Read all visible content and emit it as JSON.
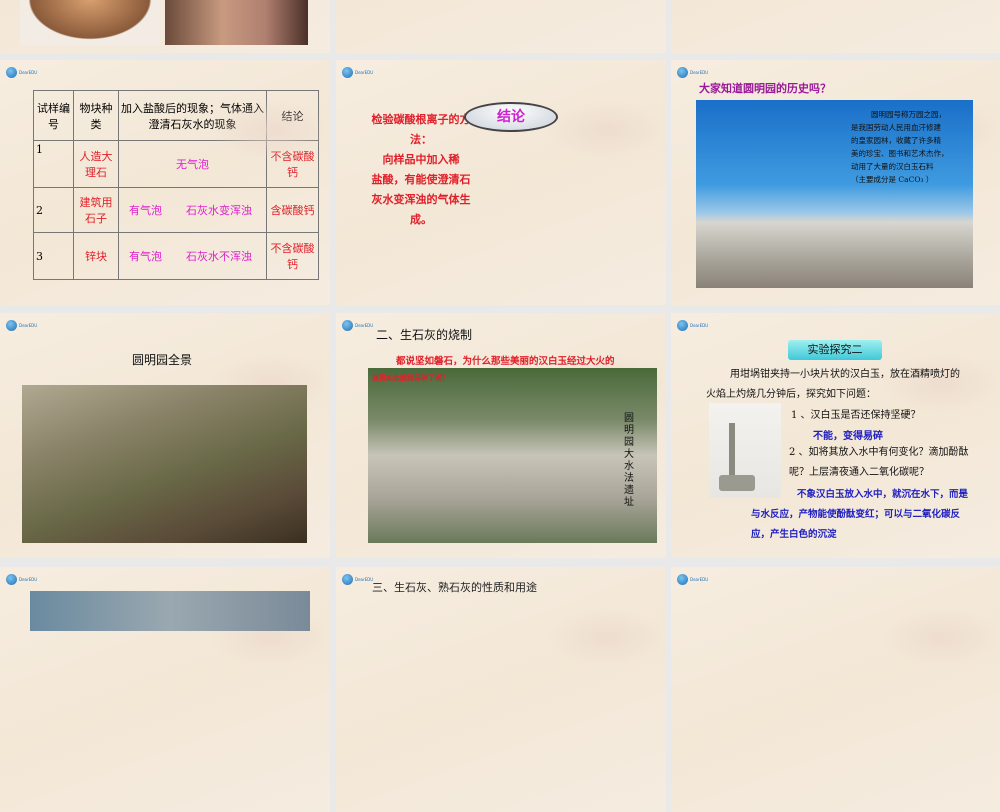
{
  "slides": [
    {
      "id": "top-partial"
    },
    {
      "table": {
        "headers": [
          "试样编号",
          "物块种类",
          "加入盐酸后的现象；气体通入澄清石灰水的现象",
          "结论"
        ],
        "rows": [
          [
            "1",
            "人造大理石",
            "无气泡",
            "",
            "不含碳酸钙"
          ],
          [
            "2",
            "建筑用石子",
            "有气泡",
            "石灰水变浑浊",
            "含碳酸钙"
          ],
          [
            "3",
            "锌块",
            "有气泡",
            "石灰水不浑浊",
            "不含碳酸钙"
          ]
        ]
      }
    },
    {
      "badge": "结论",
      "text_lines": [
        "检验碳酸根离子的方",
        "法：",
        "向样品中加入稀",
        "盐酸，有能使澄清石",
        "灰水变浑浊的气体生",
        "成。"
      ]
    },
    {
      "title": "大家知道圆明园的历史吗？",
      "caption_lines": [
        "圆明园号称万园之园，",
        "是我国劳动人民用血汗修建",
        "的皇家园林，收藏了许多精",
        "美的珍宝、图书和艺术杰作，",
        "动用了大量的汉白玉石料",
        "（主要成分是 CaCO₃ ）"
      ]
    },
    {
      "title": "圆明园全景"
    },
    {
      "title": "二、生石灰的烧制",
      "question": "都说坚如磐石，为什么那些美丽的汉白玉经过大火的",
      "question2": "变得如此脆弱易碎了呢？",
      "vertical_caption": "圆明园大水法遗址"
    },
    {
      "badge": "实验探究二",
      "intro": "用坩埚钳夹持一小块片状的汉白玉，放在酒精喷灯的火焰上灼烧几分钟后，探究如下问题：",
      "q1": "1 、汉白玉是否还保持坚硬？",
      "a1": "不能，变得易碎",
      "q2": "2 、如将其放入水中有何变化？滴加酚酞呢？上层清夜通入二氧化碳呢？",
      "a2": "不象汉白玉放入水中，就沉在水下，而是与水反应，产物能使酚酞变红；可以与二氧化碳反应，产生白色的沉淀"
    },
    {
      "title": "三、生石灰、熟石灰的性质和用途"
    }
  ]
}
